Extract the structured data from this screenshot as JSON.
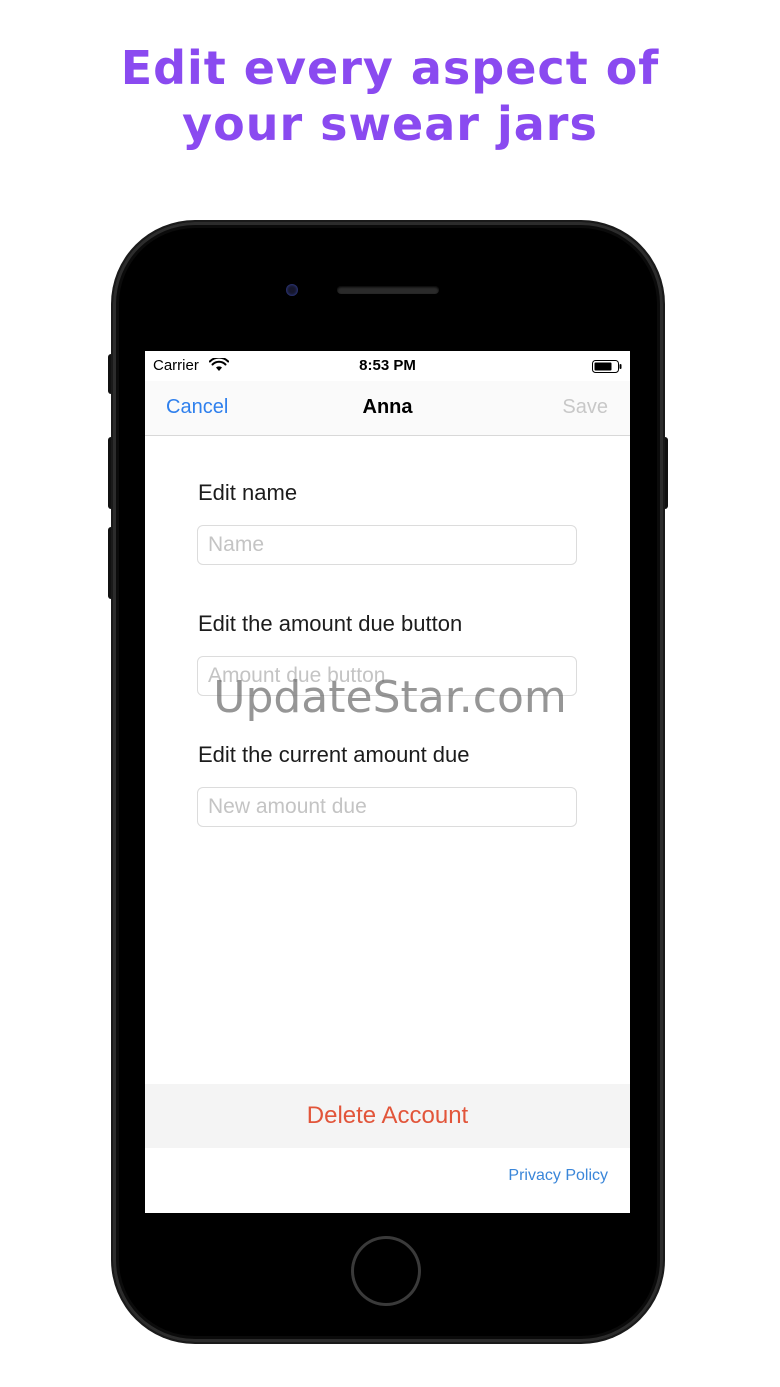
{
  "headline": {
    "line1": "Edit every aspect of",
    "line2": "your swear jars"
  },
  "colors": {
    "headline": "#8a4af0",
    "accent_blue": "#2f80ed",
    "delete_red": "#e2553a",
    "disabled_gray": "#c8c8c8"
  },
  "status_bar": {
    "carrier": "Carrier",
    "time": "8:53 PM",
    "wifi_icon": "wifi-icon",
    "battery_icon": "battery-icon"
  },
  "nav": {
    "cancel_label": "Cancel",
    "title": "Anna",
    "save_label": "Save"
  },
  "form": {
    "name_label": "Edit name",
    "name_placeholder": "Name",
    "amount_button_label": "Edit the amount due button",
    "amount_button_placeholder": "Amount due button",
    "current_due_label": "Edit the current amount due",
    "current_due_placeholder": "New amount due"
  },
  "actions": {
    "delete_label": "Delete Account",
    "privacy_label": "Privacy Policy"
  },
  "watermark": "UpdateStar.com"
}
